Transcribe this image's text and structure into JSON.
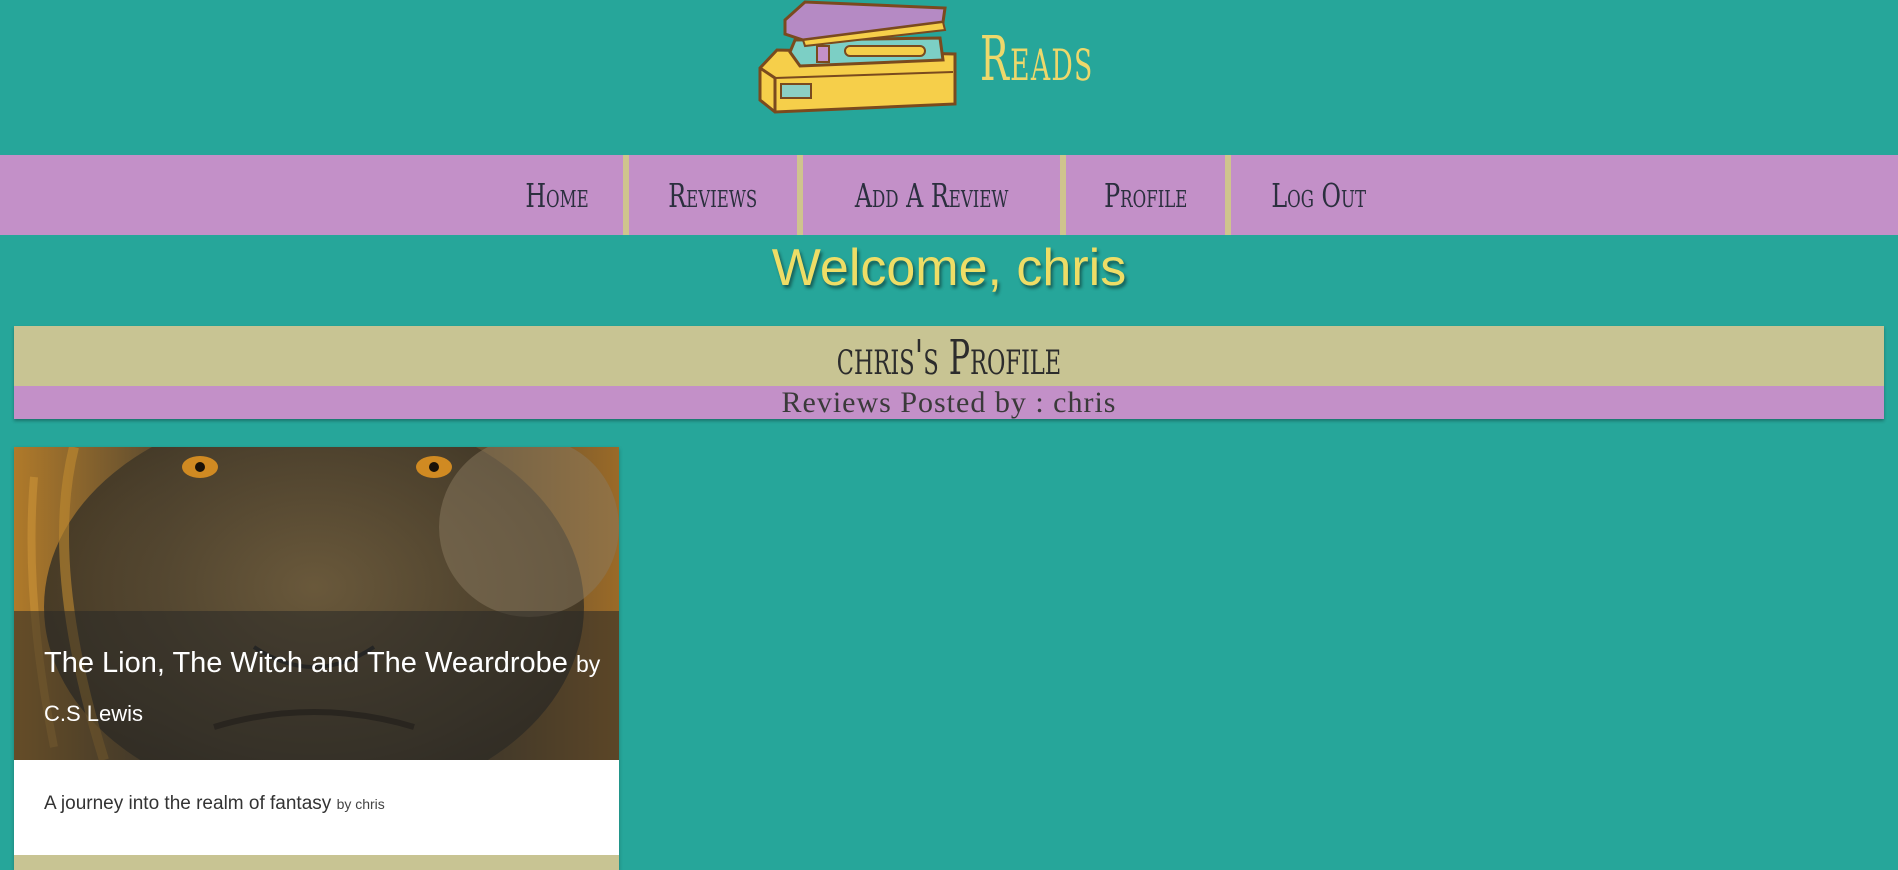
{
  "header": {
    "brand": "Reads"
  },
  "nav": {
    "items": [
      {
        "label": "Home"
      },
      {
        "label": "Reviews"
      },
      {
        "label": "Add A Review"
      },
      {
        "label": "Profile"
      },
      {
        "label": "Log Out"
      }
    ]
  },
  "welcome": "Welcome, chris",
  "profile": {
    "title": "chris's Profile",
    "subtitle": "Reviews Posted by : chris"
  },
  "reviews": [
    {
      "title": "The Lion, The Witch and The Weardrobe",
      "by_word": "by",
      "author": "C.S Lewis",
      "summary": "A journey into the realm of fantasy",
      "posted_by": "by chris"
    }
  ],
  "colors": {
    "background": "#26a69a",
    "nav": "#c390c8",
    "accent_yellow": "#eedd66",
    "banner_tan": "#c8c493"
  },
  "icons": {
    "logo": "book-stack-icon",
    "card_image": "lion-face-image"
  }
}
